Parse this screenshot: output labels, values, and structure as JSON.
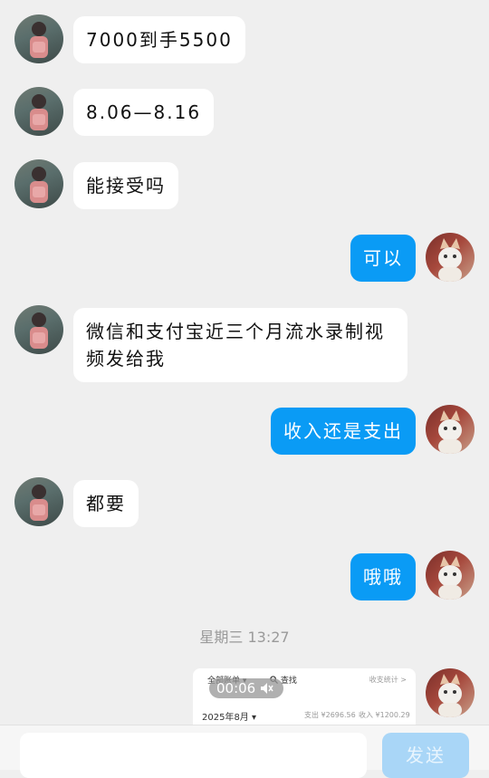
{
  "messages": [
    {
      "side": "in",
      "text": "7000到手5500"
    },
    {
      "side": "in",
      "text": "8.06—8.16"
    },
    {
      "side": "in",
      "text": "能接受吗"
    },
    {
      "side": "out",
      "text": "可以"
    },
    {
      "side": "in",
      "text": "微信和支付宝近三个月流水录制视频发给我"
    },
    {
      "side": "out",
      "text": "收入还是支出"
    },
    {
      "side": "in",
      "text": "都要"
    },
    {
      "side": "out",
      "text": "哦哦"
    }
  ],
  "timestamp": "星期三 13:27",
  "video_message": {
    "duration": "00:06",
    "bill_tab": "全部账单 ▾",
    "search": "查找",
    "stats": "收支统计 >",
    "month": "2025年8月 ▾",
    "expense": "支出 ¥2696.56",
    "income": "收入 ¥1200.29"
  },
  "composer": {
    "input_value": "",
    "send_label": "发送"
  },
  "colors": {
    "outgoing_bubble": "#0a9bf5",
    "incoming_bubble": "#ffffff",
    "send_button": "#a9d6f7"
  }
}
